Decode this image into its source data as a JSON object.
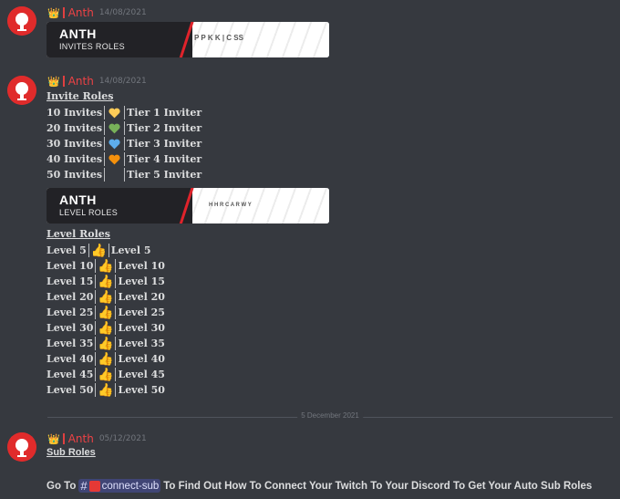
{
  "messages": [
    {
      "crown": "👑",
      "username": "Anth",
      "timestamp": "14/08/2021",
      "banner": {
        "title": "ANTH",
        "subtitle": "INVITES ROLES",
        "right_text": "P P K K  | C          SS"
      }
    },
    {
      "crown": "👑",
      "username": "Anth",
      "timestamp": "14/08/2021"
    },
    {
      "crown": "👑",
      "username": "Anth",
      "timestamp": "05/12/2021"
    }
  ],
  "invite_section": {
    "title": "Invite Roles",
    "rows": [
      {
        "count": "10 Invites",
        "role": "Tier 1 Inviter",
        "heart_color": "#fdcb58"
      },
      {
        "count": "20 Invites",
        "role": "Tier 2 Inviter",
        "heart_color": "#78b159"
      },
      {
        "count": "30 Invites",
        "role": "Tier 3 Inviter",
        "heart_color": "#5dadec"
      },
      {
        "count": "40 Invites",
        "role": "Tier 4 Inviter",
        "heart_color": "#f4900c"
      },
      {
        "count": "50 Invites",
        "role": "Tier 5 Inviter",
        "heart_color": ""
      }
    ]
  },
  "level_banner": {
    "title": "ANTH",
    "subtitle": "LEVEL ROLES",
    "right_text": "H H R C      A        R W Y"
  },
  "level_section": {
    "title": "Level Roles",
    "rows": [
      {
        "left": "Level 5",
        "right": "Level 5"
      },
      {
        "left": "Level 10",
        "right": "Level 10"
      },
      {
        "left": "Level 15",
        "right": "Level 15"
      },
      {
        "left": "Level 20",
        "right": "Level 20"
      },
      {
        "left": "Level 25",
        "right": "Level 25"
      },
      {
        "left": "Level 30",
        "right": "Level 30"
      },
      {
        "left": "Level 35",
        "right": "Level 35"
      },
      {
        "left": "Level 40",
        "right": "Level 40"
      },
      {
        "left": "Level 45",
        "right": "Level 45"
      },
      {
        "left": "Level 50",
        "right": "Level 50"
      }
    ],
    "emoji": "👍"
  },
  "date_divider": "5 December 2021",
  "sub_section": {
    "title": "Sub Roles",
    "prefix": "Go To",
    "channel_hash": "#",
    "channel_name": "connect-sub",
    "suffix": "To Find Out How To Connect Your Twitch To Your Discord To Get Your Auto Sub Roles"
  },
  "colors": {
    "background": "#36393f",
    "username": "#ed4245",
    "avatar": "#e02b2b",
    "mention_bg": "#5865f2"
  }
}
